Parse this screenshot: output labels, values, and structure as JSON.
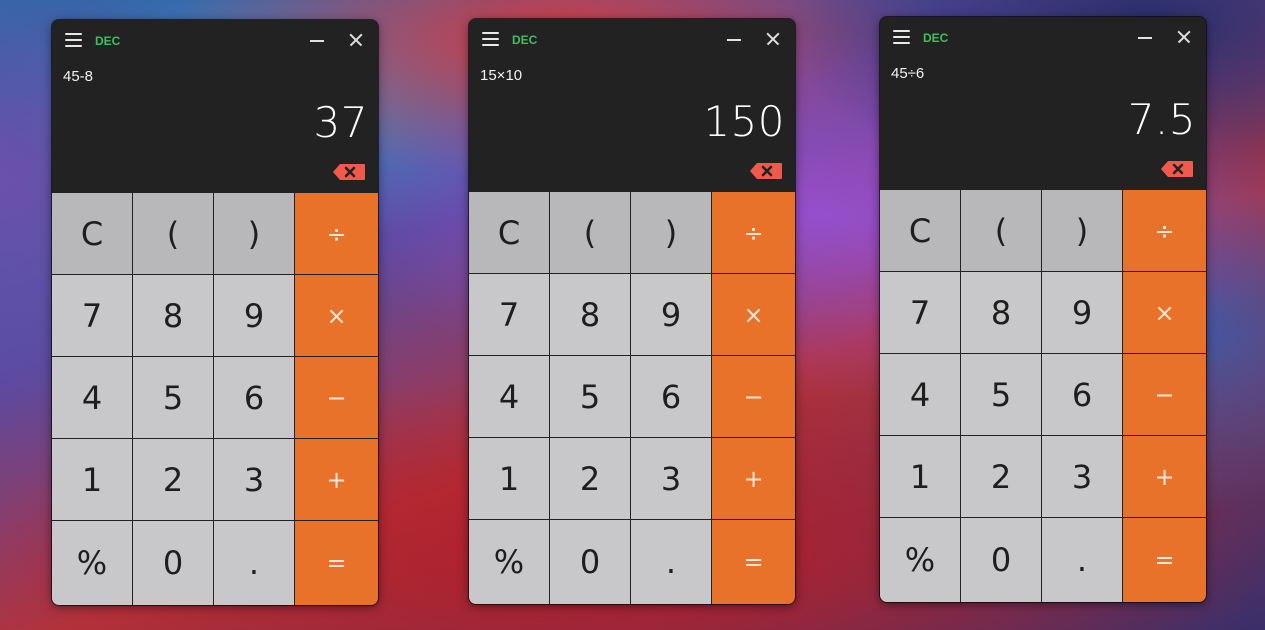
{
  "colors": {
    "mode_label": "#3fbf5f",
    "operator_key": "#e8722a",
    "backspace": "#f15a4a",
    "number_key": "#c8c8ca",
    "function_key": "#b8b8ba"
  },
  "icons": {
    "menu": "hamburger-icon",
    "minimize": "minimize-icon",
    "close": "close-icon",
    "backspace": "backspace-icon"
  },
  "keys": [
    [
      "C",
      "(",
      ")",
      "÷"
    ],
    [
      "7",
      "8",
      "9",
      "×"
    ],
    [
      "4",
      "5",
      "6",
      "−"
    ],
    [
      "1",
      "2",
      "3",
      "+"
    ],
    [
      "%",
      "0",
      ".",
      "="
    ]
  ],
  "calculators": [
    {
      "mode": "DEC",
      "expression": "45-8",
      "result": "37"
    },
    {
      "mode": "DEC",
      "expression": "15×10",
      "result": "150"
    },
    {
      "mode": "DEC",
      "expression": "45÷6",
      "result": "7.5"
    }
  ]
}
